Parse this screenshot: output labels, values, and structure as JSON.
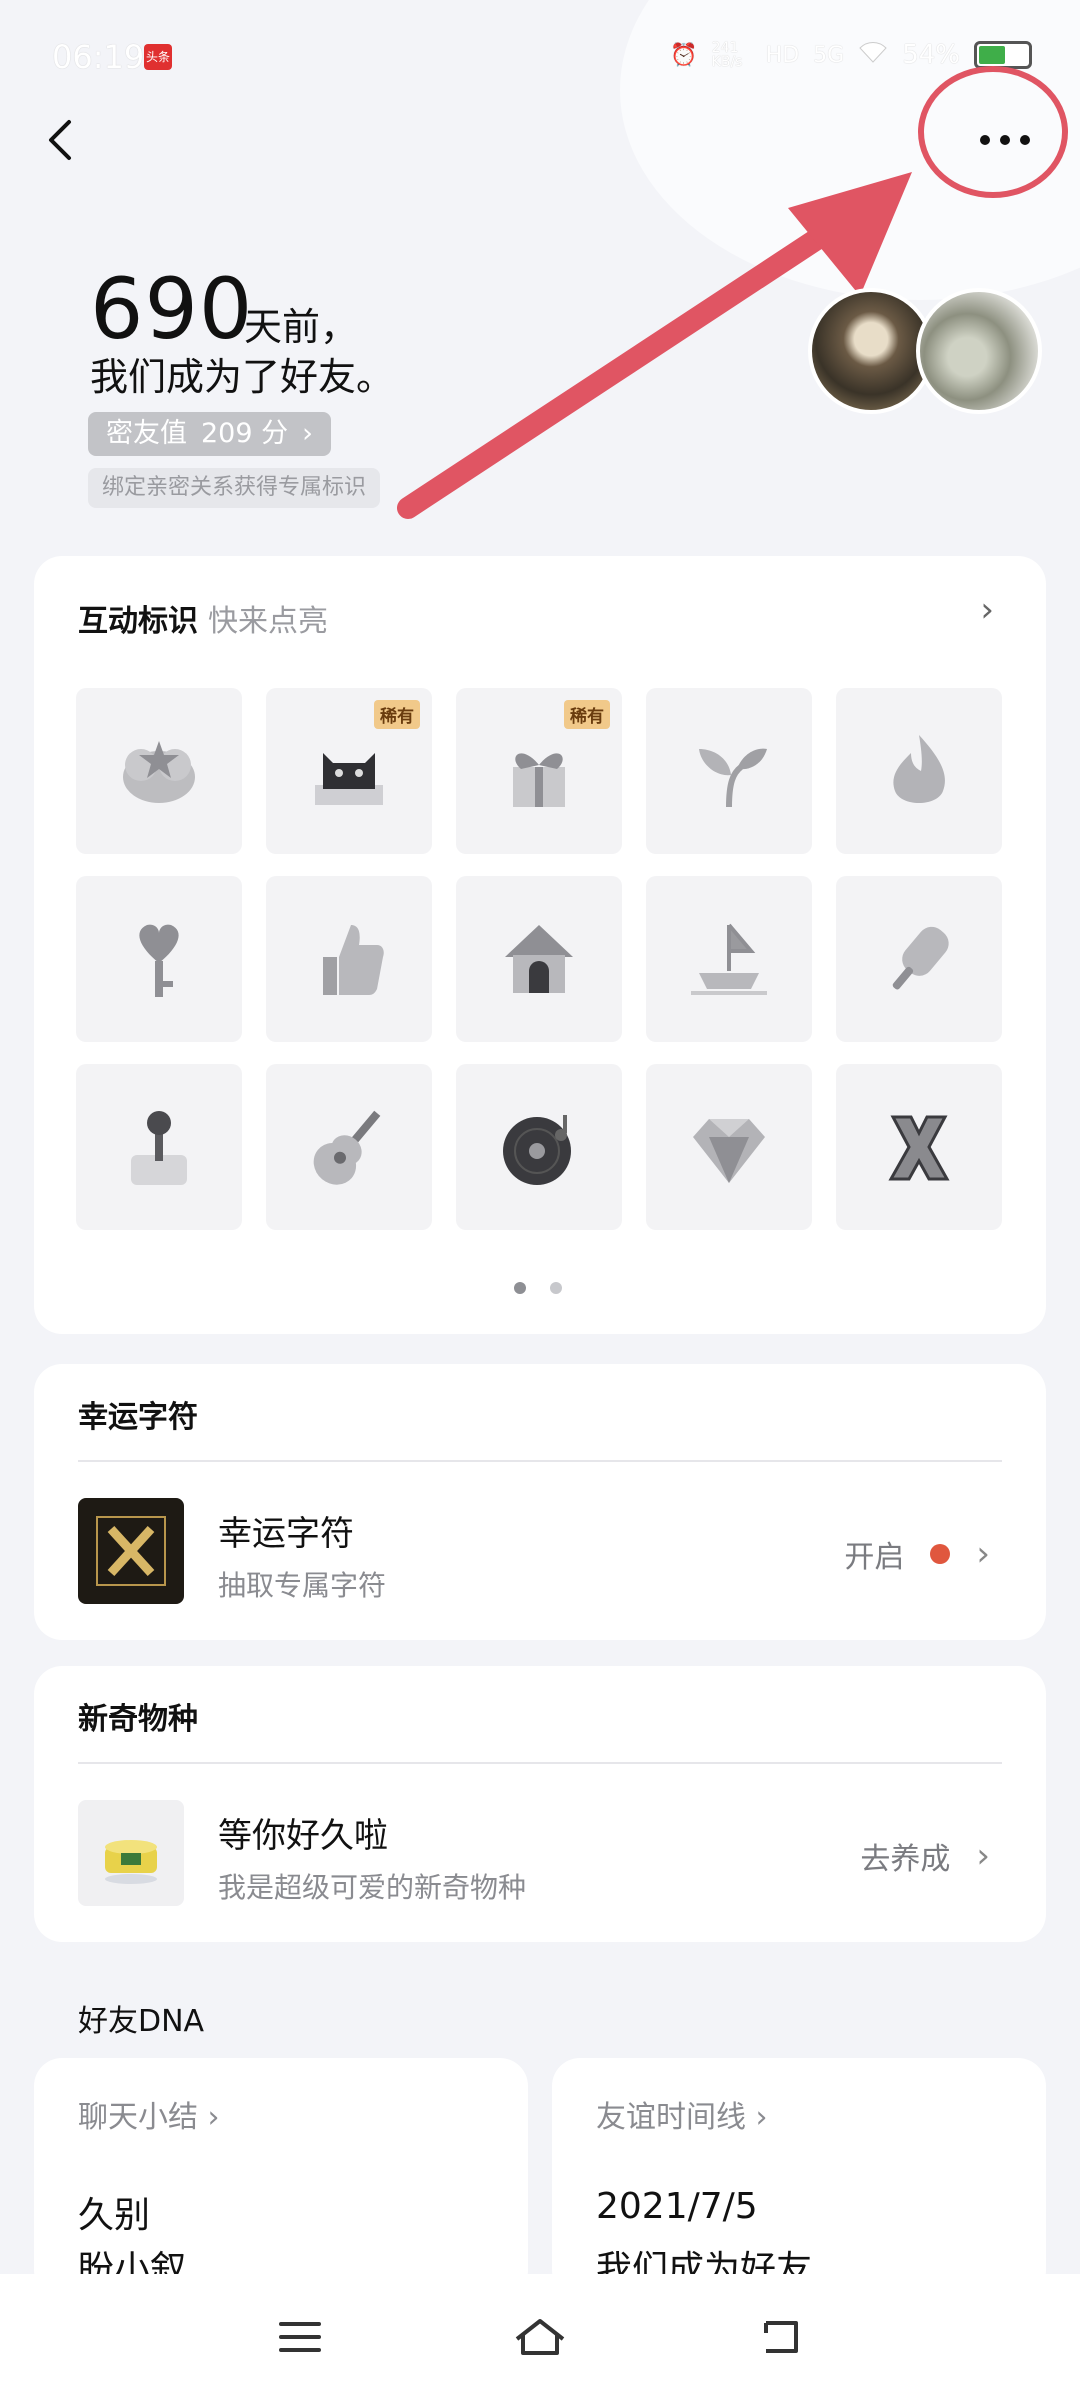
{
  "status": {
    "time": "06:19",
    "news_badge": "头条",
    "speed": "241 KB/s",
    "hd": "HD",
    "network": "5G",
    "battery": "54%",
    "battery_level": 0.54
  },
  "header": {
    "days_number": "690",
    "days_unit": "天前，",
    "friend_line": "我们成为了好友。",
    "intimacy_label": "密友值",
    "intimacy_value": "209 分",
    "bind_tip": "绑定亲密关系获得专属标识"
  },
  "interaction": {
    "title": "互动标识",
    "subtitle": "快来点亮",
    "rare_label": "稀有",
    "badges": [
      {
        "icon": "star-cloud-icon",
        "rare": false
      },
      {
        "icon": "black-cat-icon",
        "rare": true
      },
      {
        "icon": "gift-heart-icon",
        "rare": true
      },
      {
        "icon": "sprout-icon",
        "rare": false
      },
      {
        "icon": "flame-icon",
        "rare": false
      },
      {
        "icon": "heart-key-icon",
        "rare": false
      },
      {
        "icon": "thumbs-up-icon",
        "rare": false
      },
      {
        "icon": "house-icon",
        "rare": false
      },
      {
        "icon": "sailboat-icon",
        "rare": false
      },
      {
        "icon": "popsicle-icon",
        "rare": false
      },
      {
        "icon": "joystick-icon",
        "rare": false
      },
      {
        "icon": "guitar-icon",
        "rare": false
      },
      {
        "icon": "vinyl-record-icon",
        "rare": false
      },
      {
        "icon": "diamond-icon",
        "rare": false
      },
      {
        "icon": "letter-x-icon",
        "rare": false
      }
    ],
    "pages": 2,
    "active_page": 0
  },
  "lucky": {
    "title": "幸运字符",
    "item_title": "幸运字符",
    "item_desc": "抽取专属字符",
    "action": "开启"
  },
  "species": {
    "title": "新奇物种",
    "item_title": "等你好久啦",
    "item_desc": "我是超级可爱的新奇物种",
    "action": "去养成"
  },
  "dna": {
    "title": "好友DNA",
    "chat": {
      "label": "聊天小结",
      "line1": "久别",
      "line2": "盼小叙"
    },
    "timeline": {
      "label": "友谊时间线",
      "line1": "2021/7/5",
      "line2": "我们成为好友"
    }
  },
  "colors": {
    "accent_red": "#e0573e",
    "annotation_red": "#e05563",
    "rare_tag": "#f1c98a"
  }
}
